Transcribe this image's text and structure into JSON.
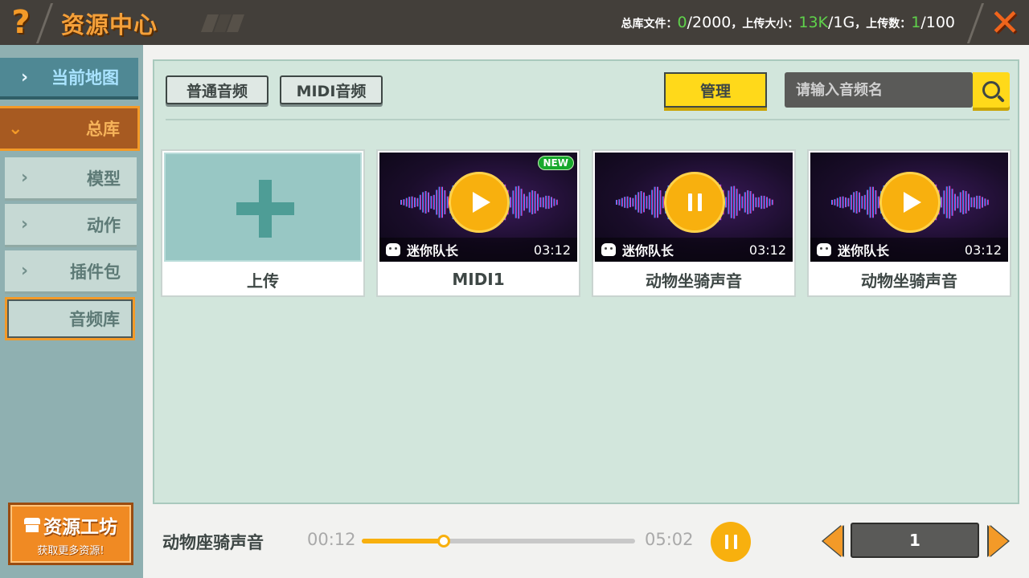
{
  "header": {
    "help_icon": "?",
    "title": "资源中心",
    "stats": {
      "files_label": "总库文件：",
      "files_used": "0",
      "files_total": "/2000",
      "sep1": "，",
      "size_label": "上传大小：",
      "size_used": "13K",
      "size_total": "/1G",
      "sep2": "，",
      "count_label": "上传数：",
      "count_used": "1",
      "count_total": "/100"
    },
    "close_icon": "✕"
  },
  "sidebar": {
    "current_map": {
      "chevron": "›",
      "label": "当前地图"
    },
    "library": {
      "chevron": "⌄",
      "label": "总库"
    },
    "sub_items": [
      {
        "chevron": "›",
        "label": "模型"
      },
      {
        "chevron": "›",
        "label": "动作"
      },
      {
        "chevron": "›",
        "label": "插件包"
      }
    ],
    "audio_library": {
      "label": "音频库"
    },
    "workshop": {
      "title": "资源工坊",
      "subtitle": "获取更多资源!"
    }
  },
  "toolbar": {
    "tab_normal": "普通音频",
    "tab_midi": "MIDI音频",
    "manage_label": "管理",
    "search_placeholder": "请输入音频名"
  },
  "cards": [
    {
      "type": "upload",
      "name": "上传"
    },
    {
      "type": "audio",
      "name": "MIDI1",
      "author": "迷你队长",
      "duration": "03:12",
      "state": "play",
      "badge": "NEW"
    },
    {
      "type": "audio",
      "name": "动物坐骑声音",
      "author": "迷你队长",
      "duration": "03:12",
      "state": "pause"
    },
    {
      "type": "audio",
      "name": "动物坐骑声音",
      "author": "迷你队长",
      "duration": "03:12",
      "state": "play"
    }
  ],
  "player": {
    "title": "动物座骑声音",
    "current_time": "00:12",
    "total_time": "05:02",
    "progress_fraction": 0.3
  },
  "pager": {
    "current_page": "1"
  },
  "colors": {
    "accent_orange": "#f39a28",
    "accent_yellow": "#ffd91a",
    "highlight_green": "#5fd24b"
  }
}
